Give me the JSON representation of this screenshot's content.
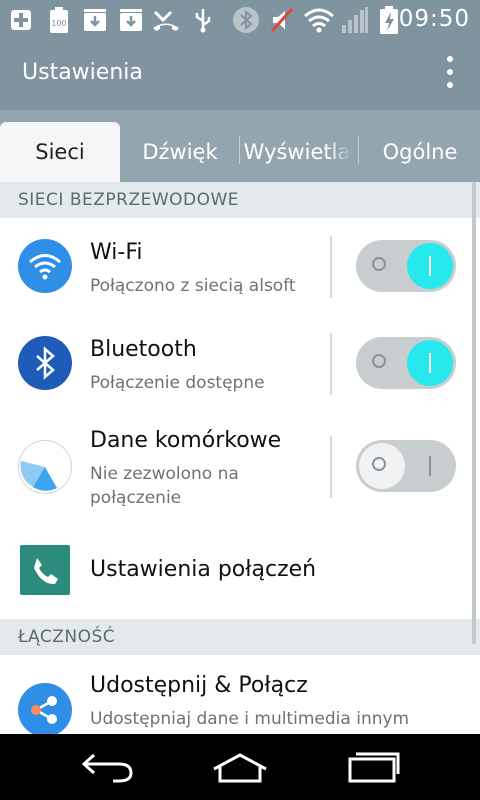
{
  "status_bar": {
    "time": "09:50",
    "icons": [
      "add-icon",
      "battery-100-icon",
      "download-icon",
      "download-icon",
      "missed-call-icon",
      "usb-icon",
      "bluetooth-icon",
      "mute-icon",
      "wifi-icon",
      "signal-icon",
      "charging-battery-icon"
    ]
  },
  "action_bar": {
    "title": "Ustawienia"
  },
  "tabs": [
    {
      "label": "Sieci",
      "active": true
    },
    {
      "label": "Dźwięk",
      "active": false
    },
    {
      "label": "Wyświetla",
      "active": false
    },
    {
      "label": "Ogólne",
      "active": false
    }
  ],
  "sections": {
    "wireless": {
      "header": "SIECI BEZPRZEWODOWE",
      "wifi": {
        "title": "Wi-Fi",
        "subtitle": "Połączono z siecią alsoft",
        "enabled": true
      },
      "bluetooth": {
        "title": "Bluetooth",
        "subtitle": "Połączenie dostępne",
        "enabled": true
      },
      "mobile_data": {
        "title": "Dane komórkowe",
        "subtitle_line1": "Nie zezwolono na",
        "subtitle_line2": "połączenie",
        "enabled": false
      },
      "call_settings": {
        "title": "Ustawienia połączeń"
      }
    },
    "connectivity": {
      "header": "ŁĄCZNOŚĆ",
      "share_connect": {
        "title": "Udostępnij & Połącz",
        "subtitle": "Udostępniaj dane i multimedia innym"
      }
    }
  },
  "colors": {
    "status_bar": "#7f949f",
    "tab_bar": "#93a5ae",
    "toggle_on": "#27e8ec",
    "wifi_icon_bg": "#2f8fe6",
    "bluetooth_icon_bg": "#1f5bb8",
    "call_icon_bg": "#2b8c7e"
  }
}
